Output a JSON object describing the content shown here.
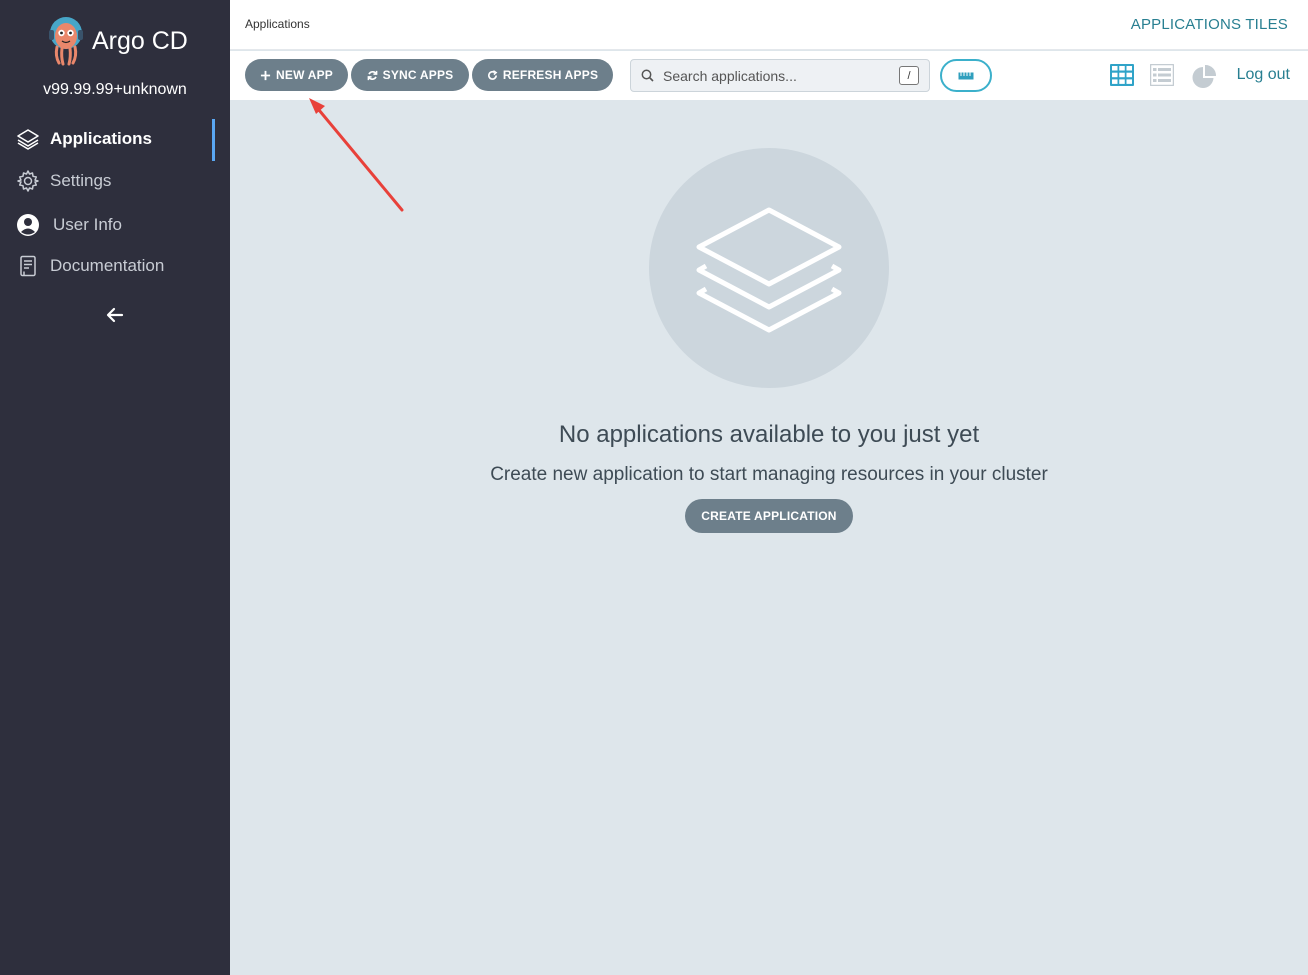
{
  "sidebar": {
    "app_name": "Argo CD",
    "version": "v99.99.99+unknown",
    "items": [
      {
        "label": "Applications",
        "icon": "layers-icon",
        "active": true
      },
      {
        "label": "Settings",
        "icon": "gear-icon",
        "active": false
      },
      {
        "label": "User Info",
        "icon": "user-circle-icon",
        "active": false
      },
      {
        "label": "Documentation",
        "icon": "book-icon",
        "active": false
      }
    ],
    "collapse_icon": "arrow-left-icon"
  },
  "header": {
    "breadcrumb": "Applications",
    "view_title": "APPLICATIONS TILES",
    "logout": "Log out"
  },
  "toolbar": {
    "new_app": "NEW APP",
    "sync_apps": "SYNC APPS",
    "refresh_apps": "REFRESH APPS",
    "search_placeholder": "Search applications...",
    "search_shortcut": "/",
    "view_icons": [
      "tiles-view-icon",
      "list-view-icon",
      "summary-pie-icon"
    ]
  },
  "empty_state": {
    "title": "No applications available to you just yet",
    "subtitle": "Create new application to start managing resources in your cluster",
    "button": "CREATE APPLICATION"
  },
  "colors": {
    "sidebar_bg": "#2e2f3d",
    "content_bg": "#dee6eb",
    "accent": "#287f91",
    "button_bg": "#6d7f8b",
    "active_indicator": "#5aa7f2",
    "annotation_arrow": "#e8413a"
  }
}
